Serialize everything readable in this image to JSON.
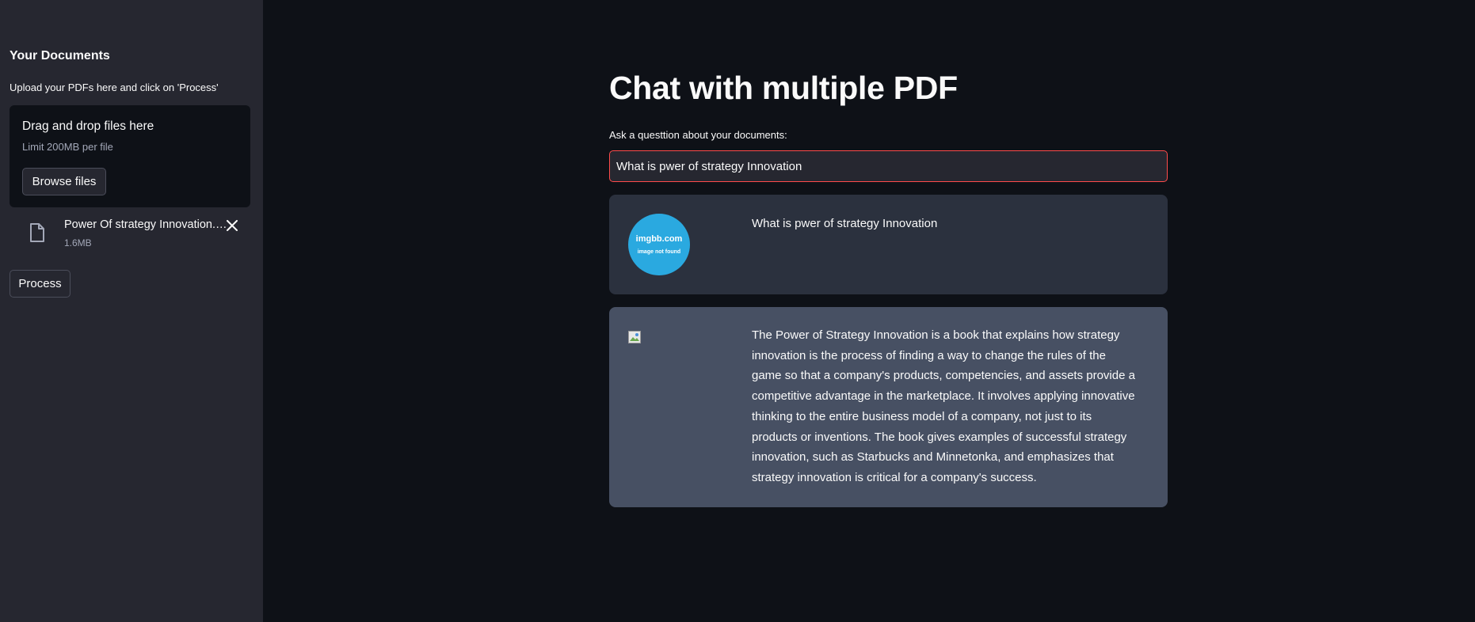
{
  "sidebar": {
    "title": "Your Documents",
    "upload_label": "Upload your PDFs here and click on 'Process'",
    "dropzone": {
      "main_text": "Drag and drop files here",
      "limit_text": "Limit 200MB per file",
      "browse_label": "Browse files"
    },
    "uploaded_file": {
      "name": "Power Of strategy Innovation.pdf",
      "size": "1.6MB",
      "icon": "file-icon"
    },
    "process_label": "Process"
  },
  "main": {
    "title": "Chat with multiple PDF",
    "question_label": "Ask a questtion about your documents:",
    "question_value": "What is pwer of strategy Innovation",
    "messages": [
      {
        "role": "user",
        "avatar_brand": "imgbb.com",
        "avatar_note": "image not found",
        "text": "What is pwer of strategy Innovation"
      },
      {
        "role": "bot",
        "avatar": "broken-image-icon",
        "text": "The Power of Strategy Innovation is a book that explains how strategy innovation is the process of finding a way to change the rules of the game so that a company's products, competencies, and assets provide a competitive advantage in the marketplace. It involves applying innovative thinking to the entire business model of a company, not just to its products or inventions. The book gives examples of successful strategy innovation, such as Starbucks and Minnetonka, and emphasizes that strategy innovation is critical for a company's success."
      }
    ]
  },
  "colors": {
    "background": "#0e1117",
    "sidebar": "#262730",
    "user_message": "#2b313e",
    "bot_message": "#475063",
    "input_focus_border": "#ff4b4b",
    "avatar": "#2aa9e0"
  }
}
